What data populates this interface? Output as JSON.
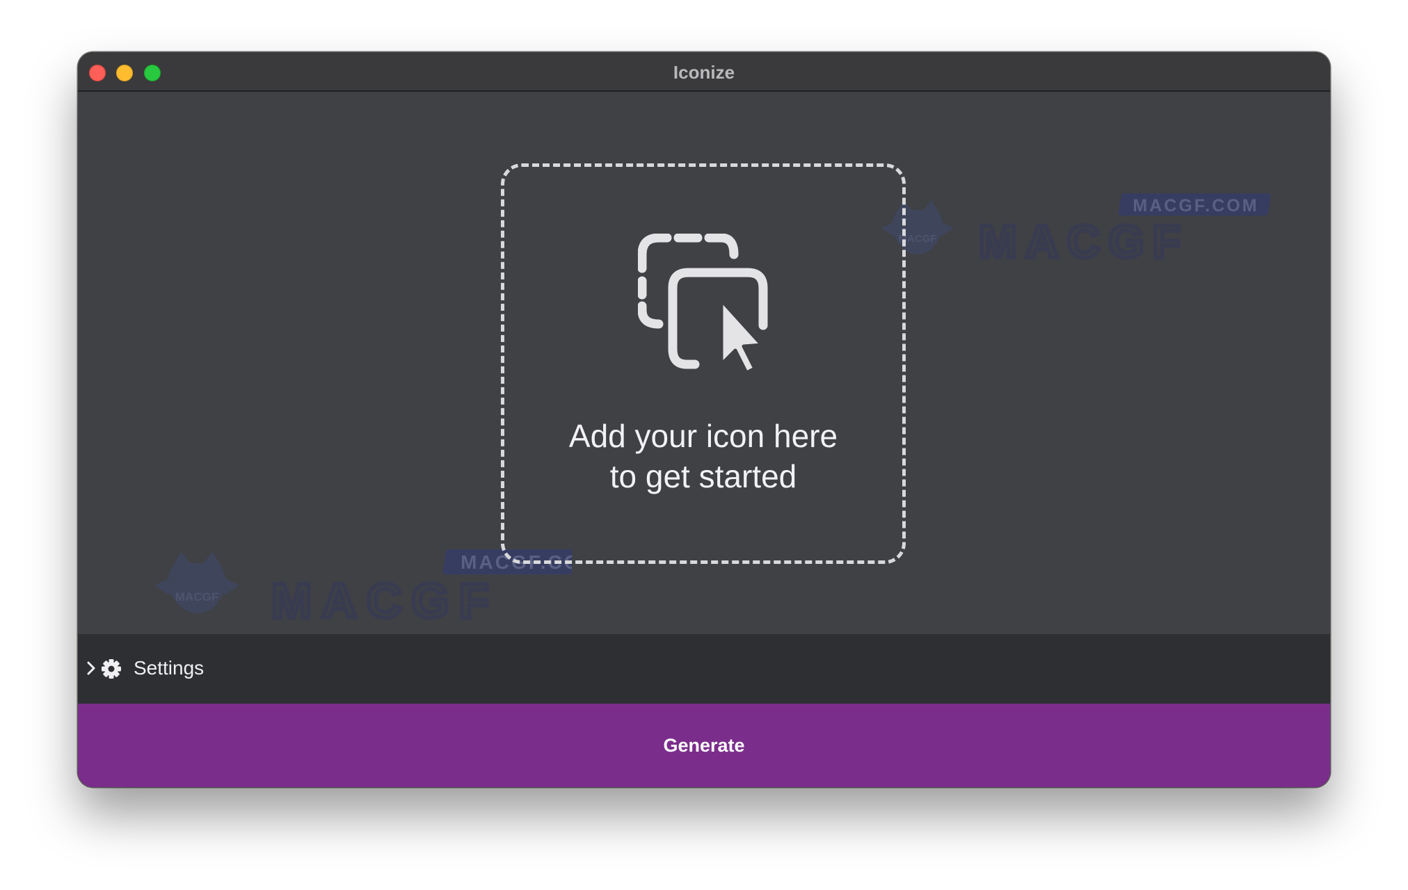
{
  "window": {
    "title": "Iconize"
  },
  "dropzone": {
    "line1": "Add your icon here",
    "line2": "to get started",
    "icon": "cursor-in-frames-icon"
  },
  "settings": {
    "label": "Settings",
    "expanded": false
  },
  "generate": {
    "label": "Generate"
  },
  "watermarks": [
    {
      "label": "MACGF.COM",
      "logo": "MACGF",
      "wordmark": "MACGF"
    },
    {
      "label": "MACGF.COM",
      "logo": "MACGF",
      "wordmark": "MACGF"
    }
  ],
  "colors": {
    "content_bg": "#404145",
    "titlebar_bg": "#3a3a3c",
    "settings_bg": "#2e2f33",
    "accent": "#7b2d8c",
    "close": "#ff5f57",
    "minimize": "#febc2e",
    "maximize": "#28c840"
  }
}
